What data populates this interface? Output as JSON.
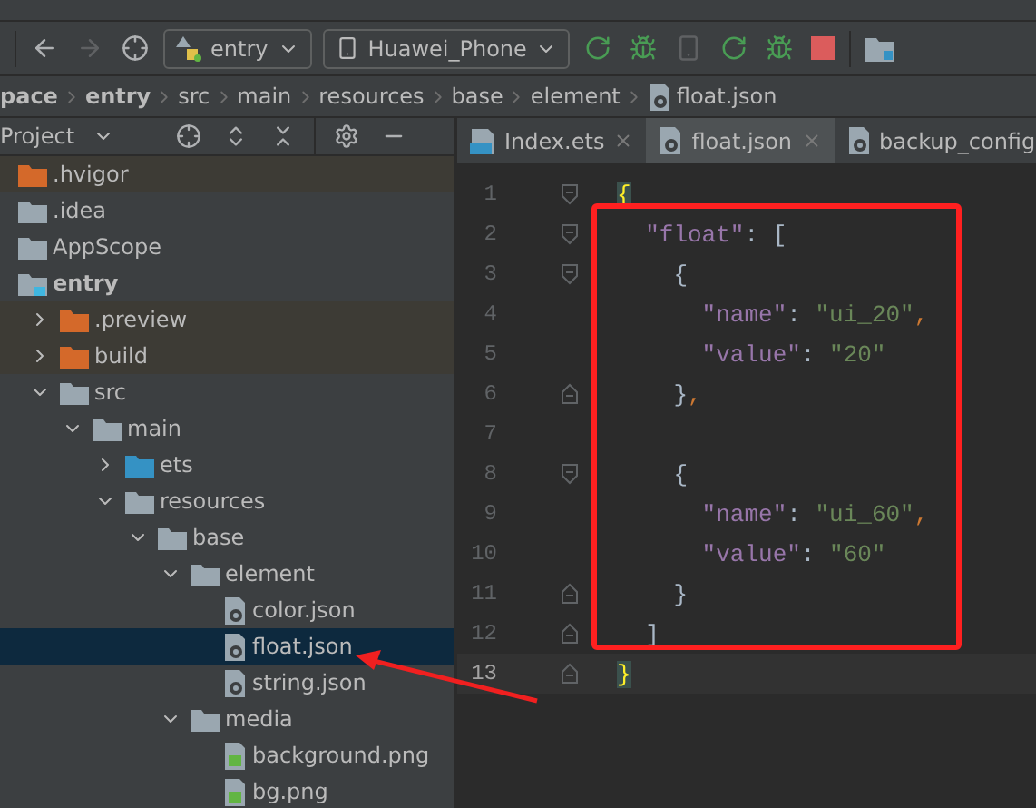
{
  "toolbar": {
    "module": "entry",
    "device": "Huawei_Phone"
  },
  "breadcrumb": [
    {
      "label": "pace",
      "bold": true
    },
    {
      "label": "entry",
      "bold": true
    },
    {
      "label": "src",
      "bold": false
    },
    {
      "label": "main",
      "bold": false
    },
    {
      "label": "resources",
      "bold": false
    },
    {
      "label": "base",
      "bold": false
    },
    {
      "label": "element",
      "bold": false
    },
    {
      "label": "float.json",
      "bold": false
    }
  ],
  "project_panel": {
    "title": "Project",
    "tree": [
      {
        "label": ".hvigor",
        "kind": "excluded-folder",
        "selected": false
      },
      {
        "label": ".idea",
        "kind": "folder",
        "selected": false
      },
      {
        "label": "AppScope",
        "kind": "folder",
        "selected": false
      },
      {
        "label": "entry",
        "kind": "module",
        "selected": false,
        "children": [
          {
            "label": ".preview",
            "kind": "excluded-folder",
            "expanded": false,
            "selected": false
          },
          {
            "label": "build",
            "kind": "excluded-folder",
            "expanded": false,
            "selected": false
          },
          {
            "label": "src",
            "kind": "folder",
            "expanded": true,
            "selected": false,
            "children": [
              {
                "label": "main",
                "kind": "folder",
                "expanded": true,
                "selected": false,
                "children": [
                  {
                    "label": "ets",
                    "kind": "source-folder",
                    "expanded": false,
                    "selected": false
                  },
                  {
                    "label": "resources",
                    "kind": "folder",
                    "expanded": true,
                    "selected": false,
                    "children": [
                      {
                        "label": "base",
                        "kind": "folder",
                        "expanded": true,
                        "selected": false,
                        "children": [
                          {
                            "label": "element",
                            "kind": "folder",
                            "expanded": true,
                            "selected": false,
                            "children": [
                              {
                                "label": "color.json",
                                "kind": "json-file",
                                "selected": false
                              },
                              {
                                "label": "float.json",
                                "kind": "json-file",
                                "selected": true
                              },
                              {
                                "label": "string.json",
                                "kind": "json-file",
                                "selected": false
                              }
                            ]
                          },
                          {
                            "label": "media",
                            "kind": "folder",
                            "expanded": true,
                            "selected": false,
                            "children": [
                              {
                                "label": "background.png",
                                "kind": "image-file",
                                "selected": false
                              },
                              {
                                "label": "bg.png",
                                "kind": "image-file",
                                "selected": false
                              }
                            ]
                          }
                        ]
                      }
                    ]
                  }
                ]
              }
            ]
          }
        ]
      }
    ]
  },
  "tabs": [
    {
      "label": "Index.ets",
      "kind": "ets",
      "selected": false
    },
    {
      "label": "float.json",
      "kind": "json",
      "selected": true
    },
    {
      "label": "backup_config",
      "kind": "json",
      "selected": false
    }
  ],
  "editor": {
    "lines": [
      {
        "number": "1",
        "fold_start": true,
        "fold_end": false,
        "current": false,
        "tokens": [
          {
            "kind": "brace-match",
            "text": "{"
          }
        ]
      },
      {
        "number": "2",
        "fold_start": true,
        "fold_end": false,
        "current": false,
        "tokens": [
          {
            "kind": "key",
            "text": "  \"float\""
          },
          {
            "kind": "punct",
            "text": ": ["
          }
        ]
      },
      {
        "number": "3",
        "fold_start": true,
        "fold_end": false,
        "current": false,
        "tokens": [
          {
            "kind": "punct",
            "text": "    {"
          }
        ]
      },
      {
        "number": "4",
        "fold_start": false,
        "fold_end": false,
        "current": false,
        "tokens": [
          {
            "kind": "key",
            "text": "      \"name\""
          },
          {
            "kind": "punct",
            "text": ": "
          },
          {
            "kind": "string",
            "text": "\"ui_20\""
          },
          {
            "kind": "comma",
            "text": ","
          }
        ]
      },
      {
        "number": "5",
        "fold_start": false,
        "fold_end": false,
        "current": false,
        "tokens": [
          {
            "kind": "key",
            "text": "      \"value\""
          },
          {
            "kind": "punct",
            "text": ": "
          },
          {
            "kind": "string",
            "text": "\"20\""
          }
        ]
      },
      {
        "number": "6",
        "fold_start": false,
        "fold_end": true,
        "current": false,
        "tokens": [
          {
            "kind": "punct",
            "text": "    }"
          },
          {
            "kind": "comma",
            "text": ","
          }
        ]
      },
      {
        "number": "7",
        "fold_start": false,
        "fold_end": false,
        "current": false
      },
      {
        "number": "8",
        "fold_start": true,
        "fold_end": false,
        "current": false,
        "tokens": [
          {
            "kind": "punct",
            "text": "    {"
          }
        ]
      },
      {
        "number": "9",
        "fold_start": false,
        "fold_end": false,
        "current": false,
        "tokens": [
          {
            "kind": "key",
            "text": "      \"name\""
          },
          {
            "kind": "punct",
            "text": ": "
          },
          {
            "kind": "string",
            "text": "\"ui_60\""
          },
          {
            "kind": "comma",
            "text": ","
          }
        ]
      },
      {
        "number": "10",
        "fold_start": false,
        "fold_end": false,
        "current": false,
        "tokens": [
          {
            "kind": "key",
            "text": "      \"value\""
          },
          {
            "kind": "punct",
            "text": ": "
          },
          {
            "kind": "string",
            "text": "\"60\""
          }
        ]
      },
      {
        "number": "11",
        "fold_start": false,
        "fold_end": true,
        "current": false,
        "tokens": [
          {
            "kind": "punct",
            "text": "    }"
          }
        ]
      },
      {
        "number": "12",
        "fold_start": false,
        "fold_end": true,
        "current": false,
        "tokens": [
          {
            "kind": "punct",
            "text": "  ]"
          }
        ]
      },
      {
        "number": "13",
        "fold_start": false,
        "fold_end": true,
        "current": true,
        "tokens": [
          {
            "kind": "brace-match",
            "text": "}"
          }
        ]
      }
    ]
  }
}
